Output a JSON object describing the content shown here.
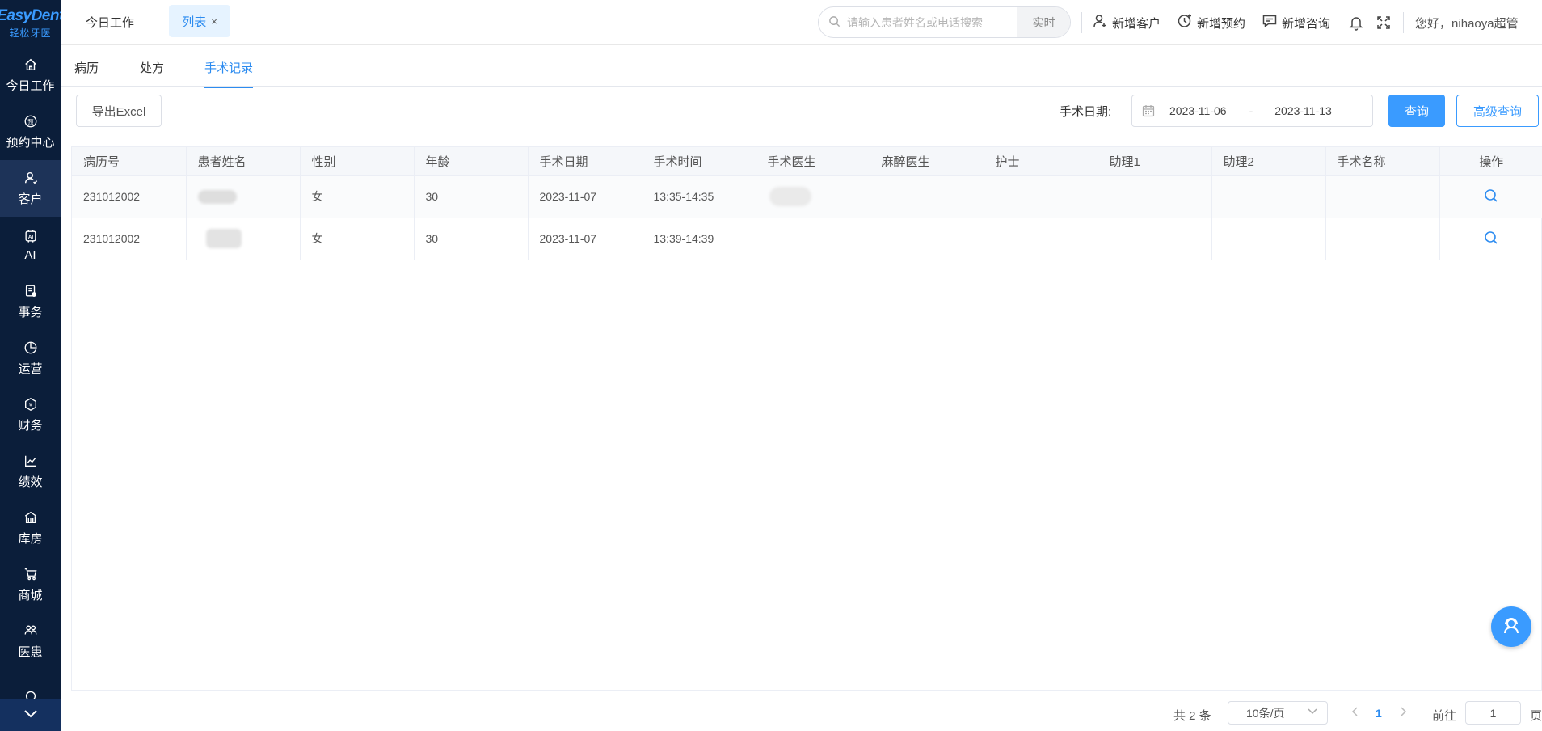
{
  "sidebar": {
    "logo_top": "EasyDent",
    "logo_bottom": "轻松牙医",
    "items": [
      {
        "label": "今日工作",
        "icon": "home-icon"
      },
      {
        "label": "预约中心",
        "icon": "appointment-icon"
      },
      {
        "label": "客户",
        "icon": "customer-icon",
        "active": true
      },
      {
        "label": "AI",
        "icon": "ai-icon"
      },
      {
        "label": "事务",
        "icon": "tasks-icon"
      },
      {
        "label": "运营",
        "icon": "pie-chart-icon"
      },
      {
        "label": "财务",
        "icon": "finance-icon"
      },
      {
        "label": "绩效",
        "icon": "line-chart-icon"
      },
      {
        "label": "库房",
        "icon": "warehouse-icon"
      },
      {
        "label": "商城",
        "icon": "cart-icon"
      },
      {
        "label": "医患",
        "icon": "doctor-patient-icon"
      }
    ]
  },
  "topbar": {
    "tab_home": "今日工作",
    "tab_list": "列表",
    "tab_close": "×",
    "search_placeholder": "请输入患者姓名或电话搜索",
    "search_button": "实时",
    "new_customer": "新增客户",
    "new_appointment": "新增预约",
    "new_consult": "新增咨询",
    "greeting": "您好，nihaoya超管"
  },
  "subtabs": [
    "病历",
    "处方",
    "手术记录"
  ],
  "toolbar": {
    "export": "导出Excel",
    "date_label": "手术日期:",
    "date_start": "2023-11-06",
    "date_sep": "-",
    "date_end": "2023-11-13",
    "query": "查询",
    "advanced": "高级查询"
  },
  "table": {
    "headers": [
      "病历号",
      "患者姓名",
      "性别",
      "年龄",
      "手术日期",
      "手术时间",
      "手术医生",
      "麻醉医生",
      "护士",
      "助理1",
      "助理2",
      "手术名称",
      "操作"
    ],
    "rows": [
      {
        "record_no": "231012002",
        "gender": "女",
        "age": "30",
        "date": "2023-11-07",
        "time": "13:35-14:35"
      },
      {
        "record_no": "231012002",
        "gender": "女",
        "age": "30",
        "date": "2023-11-07",
        "time": "13:39-14:39"
      }
    ]
  },
  "pager": {
    "total": "共 2 条",
    "size": "10条/页",
    "page": "1",
    "goto_label": "前往",
    "goto_value": "1",
    "suffix": "页"
  },
  "colors": {
    "sidebar": "#0b1e3a",
    "accent": "#3a9bff"
  }
}
